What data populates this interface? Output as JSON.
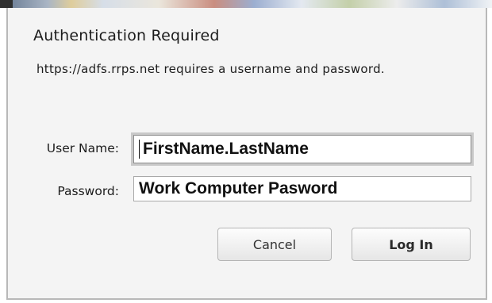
{
  "dialog": {
    "title": "Authentication Required",
    "message": "https://adfs.rrps.net requires a username and password.",
    "username_label": "User Name:",
    "username_value": "FirstName.LastName",
    "password_label": "Password:",
    "password_value": "Work Computer Pasword",
    "cancel_label": "Cancel",
    "login_label": "Log In"
  },
  "colors": {
    "dialog_background": "#f4f4f4",
    "focus_ring": "#c9c9c9"
  }
}
